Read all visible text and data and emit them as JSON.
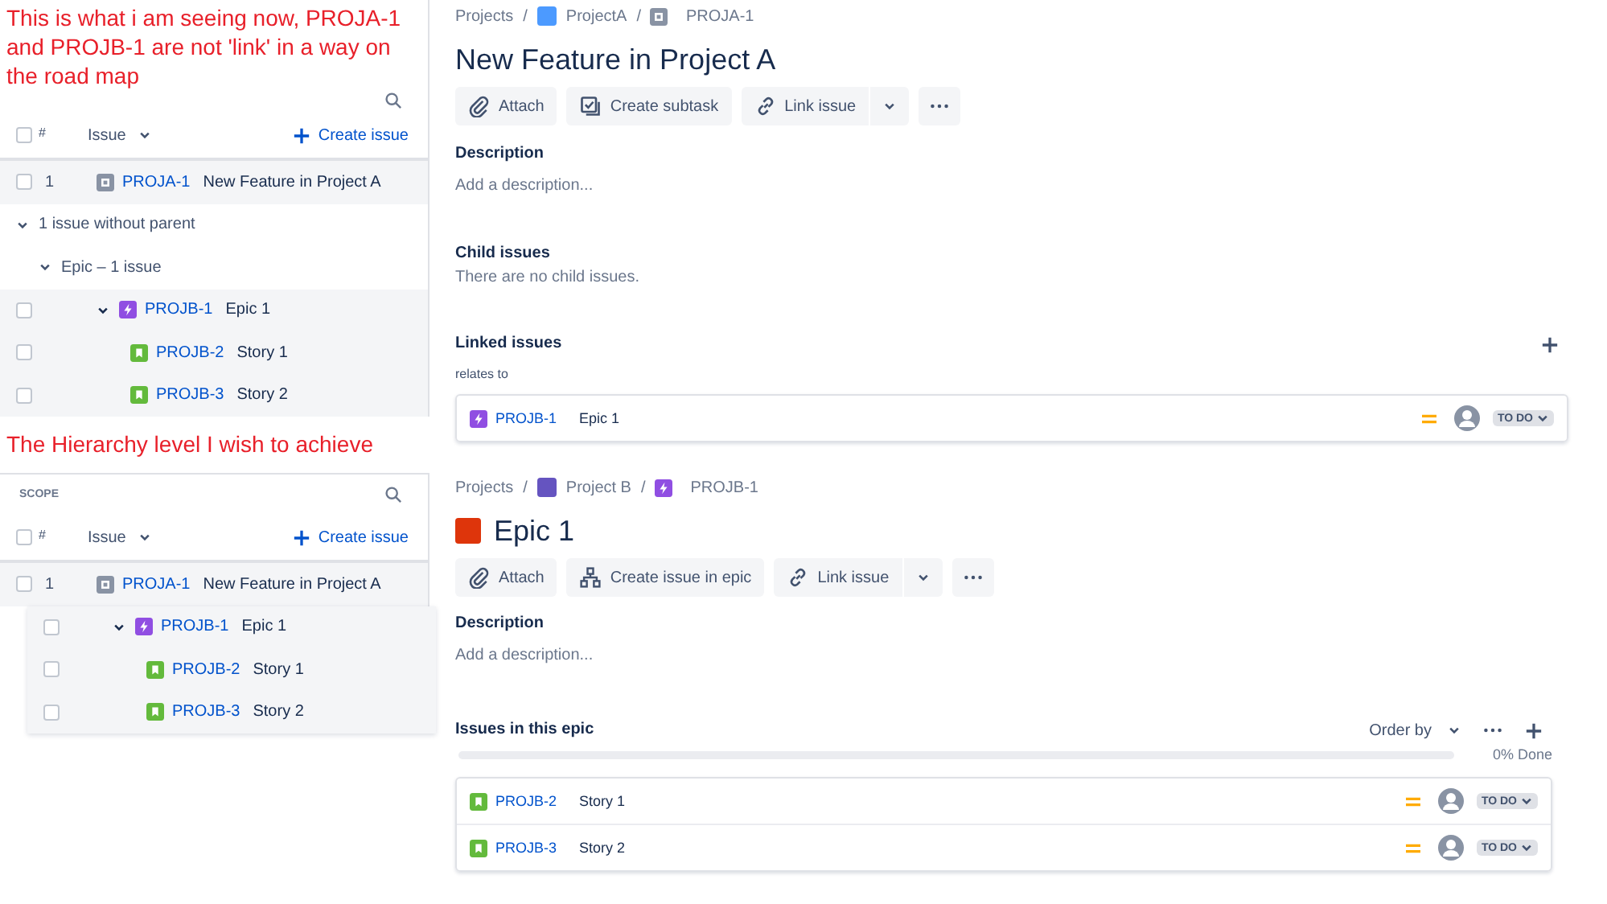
{
  "current_view": {
    "note": "This is what i am seeing now, PROJA-1 and PROJB-1 are not 'link' in a way on the road map",
    "columns": {
      "checked": false,
      "number": "#",
      "issue": "Issue",
      "create": "Create issue"
    },
    "rows": [
      {
        "kind": "feature",
        "checked": false,
        "number": "1",
        "key": "PROJA-1",
        "summary": "New Feature in Project A"
      },
      {
        "kind": "group",
        "expanded": true,
        "label": "1 issue without parent",
        "children": [
          {
            "kind": "group",
            "expanded": true,
            "label": "Epic – 1 issue",
            "children": [
              {
                "kind": "epic",
                "checked": false,
                "expanded": true,
                "key": "PROJB-1",
                "summary": "Epic 1",
                "children": [
                  {
                    "kind": "story",
                    "checked": false,
                    "key": "PROJB-2",
                    "summary": "Story 1"
                  },
                  {
                    "kind": "story",
                    "checked": false,
                    "key": "PROJB-3",
                    "summary": "Story 2"
                  }
                ]
              }
            ]
          }
        ]
      }
    ]
  },
  "target_view": {
    "note": "The Hierarchy level I wish to achieve",
    "scope_label": "SCOPE",
    "columns": {
      "checked": false,
      "number": "#",
      "issue": "Issue",
      "create": "Create issue"
    },
    "rows": [
      {
        "kind": "feature",
        "checked": false,
        "number": "1",
        "key": "PROJA-1",
        "summary": "New Feature in Project A",
        "children": [
          {
            "kind": "epic",
            "checked": false,
            "expanded": true,
            "key": "PROJB-1",
            "summary": "Epic 1",
            "children": [
              {
                "kind": "story",
                "checked": false,
                "key": "PROJB-2",
                "summary": "Story 1"
              },
              {
                "kind": "story",
                "checked": false,
                "key": "PROJB-3",
                "summary": "Story 2"
              }
            ]
          }
        ]
      }
    ]
  },
  "issue_a": {
    "breadcrumbs": {
      "separator": "/",
      "items": [
        {
          "kind": "text",
          "label": "Projects"
        },
        {
          "kind": "project",
          "label": "ProjectA",
          "color": "#4c9aff"
        },
        {
          "kind": "feature",
          "label": "PROJA-1"
        }
      ]
    },
    "title": "New Feature in Project A",
    "actions": [
      {
        "kind": "attach",
        "label": "Attach"
      },
      {
        "kind": "subtask",
        "label": "Create subtask"
      },
      {
        "kind": "link",
        "label": "Link issue"
      }
    ],
    "description": {
      "label": "Description",
      "placeholder": "Add a description..."
    },
    "child_issues": {
      "label": "Child issues",
      "empty_text": "There are no child issues."
    },
    "linked_issues": {
      "label": "Linked issues",
      "relation": "relates to",
      "items": [
        {
          "kind": "epic",
          "key": "PROJB-1",
          "summary": "Epic 1",
          "status": "TO DO"
        }
      ]
    }
  },
  "issue_b": {
    "breadcrumbs": {
      "separator": "/",
      "items": [
        {
          "kind": "text",
          "label": "Projects"
        },
        {
          "kind": "project",
          "label": "Project B",
          "color": "#6554c0"
        },
        {
          "kind": "epic",
          "label": "PROJB-1"
        }
      ]
    },
    "title": "Epic 1",
    "actions": [
      {
        "kind": "attach",
        "label": "Attach"
      },
      {
        "kind": "hierarchy",
        "label": "Create issue in epic"
      },
      {
        "kind": "link",
        "label": "Link issue"
      }
    ],
    "description": {
      "label": "Description",
      "placeholder": "Add a description..."
    },
    "epic_issues": {
      "label": "Issues in this epic",
      "order_label": "Order by",
      "level": 0,
      "reading": "0% Done",
      "items": [
        {
          "kind": "story",
          "key": "PROJB-2",
          "summary": "Story 1",
          "status": "TO DO"
        },
        {
          "kind": "story",
          "key": "PROJB-3",
          "summary": "Story 2",
          "status": "TO DO"
        }
      ]
    }
  }
}
